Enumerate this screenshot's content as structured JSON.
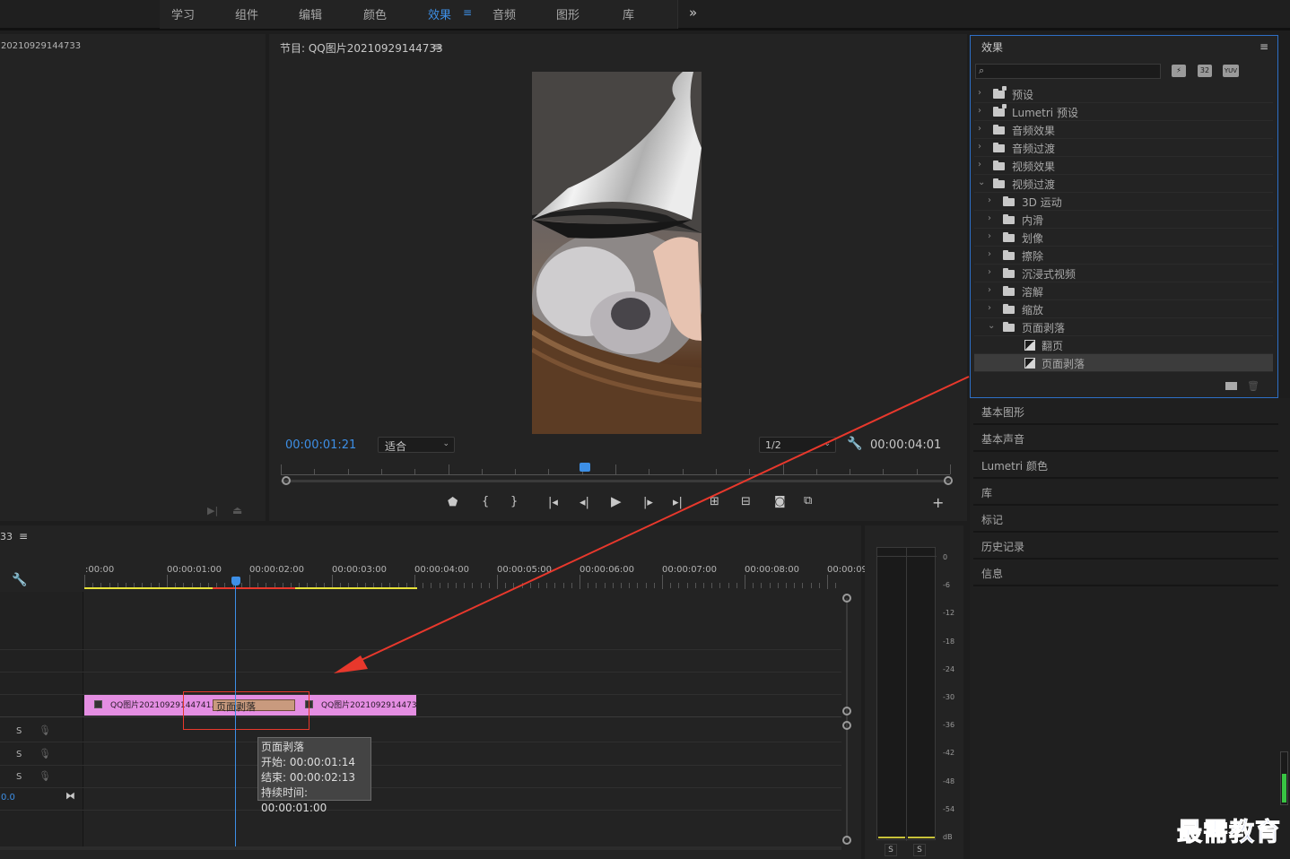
{
  "workspace_tabs": [
    {
      "label": "学习"
    },
    {
      "label": "组件"
    },
    {
      "label": "编辑"
    },
    {
      "label": "颜色"
    },
    {
      "label": "效果",
      "active": true
    },
    {
      "label": "音频"
    },
    {
      "label": "图形"
    },
    {
      "label": "库"
    }
  ],
  "workspace_menu_icon": "hamburger-icon",
  "workspace_overflow_label": "»",
  "source_panel": {
    "title": "20210929144733"
  },
  "program_monitor": {
    "title": "节目: QQ图片20210929144733",
    "current_timecode": "00:00:01:21",
    "fit_label": "适合",
    "resolution_label": "1/2",
    "duration_timecode": "00:00:04:01",
    "playhead_fraction": 0.45
  },
  "effects_panel": {
    "title": "效果",
    "search_placeholder": "",
    "filter_badges": [
      "32",
      "YUV"
    ],
    "tree": [
      {
        "label": "预设",
        "depth": 0,
        "expanded": false,
        "icon": "preset-bin-icon"
      },
      {
        "label": "Lumetri 预设",
        "depth": 0,
        "expanded": false,
        "icon": "preset-bin-icon"
      },
      {
        "label": "音频效果",
        "depth": 0,
        "expanded": false,
        "icon": "folder-icon"
      },
      {
        "label": "音频过渡",
        "depth": 0,
        "expanded": false,
        "icon": "folder-icon"
      },
      {
        "label": "视频效果",
        "depth": 0,
        "expanded": false,
        "icon": "folder-icon"
      },
      {
        "label": "视频过渡",
        "depth": 0,
        "expanded": true,
        "icon": "folder-icon"
      },
      {
        "label": "3D 运动",
        "depth": 1,
        "expanded": false,
        "icon": "folder-icon"
      },
      {
        "label": "内滑",
        "depth": 1,
        "expanded": false,
        "icon": "folder-icon"
      },
      {
        "label": "划像",
        "depth": 1,
        "expanded": false,
        "icon": "folder-icon"
      },
      {
        "label": "擦除",
        "depth": 1,
        "expanded": false,
        "icon": "folder-icon"
      },
      {
        "label": "沉浸式视频",
        "depth": 1,
        "expanded": false,
        "icon": "folder-icon"
      },
      {
        "label": "溶解",
        "depth": 1,
        "expanded": false,
        "icon": "folder-icon"
      },
      {
        "label": "缩放",
        "depth": 1,
        "expanded": false,
        "icon": "folder-icon"
      },
      {
        "label": "页面剥落",
        "depth": 1,
        "expanded": true,
        "icon": "folder-icon"
      },
      {
        "label": "翻页",
        "depth": 2,
        "icon": "transition-icon"
      },
      {
        "label": "页面剥落",
        "depth": 2,
        "icon": "transition-icon",
        "selected": true
      }
    ]
  },
  "side_panels": [
    "基本图形",
    "基本声音",
    "Lumetri 颜色",
    "库",
    "标记",
    "历史记录",
    "信息"
  ],
  "timeline": {
    "title": "33",
    "ruler_labels": [
      ":00:00",
      "00:00:01:00",
      "00:00:02:00",
      "00:00:03:00",
      "00:00:04:00",
      "00:00:05:00",
      "00:00:06:00",
      "00:00:07:00",
      "00:00:08:00",
      "00:00:09:"
    ],
    "clip_a": "QQ图片20210929144741.",
    "transition": "页面剥落",
    "clip_b": "QQ图片2021092914473",
    "audio_track_labels": [
      "S",
      "S",
      "S"
    ],
    "master_value": "0.0",
    "tooltip": {
      "name": "页面剥落",
      "start": "开始: 00:00:01:14",
      "end": "结束: 00:00:02:13",
      "duration": "持续时间: 00:00:01:00"
    }
  },
  "audio_meter": {
    "db_labels": [
      "0",
      "-6",
      "-12",
      "-18",
      "-24",
      "-30",
      "-36",
      "-42",
      "-48",
      "-54",
      "dB"
    ],
    "solo_labels": [
      "S",
      "S"
    ]
  },
  "watermark": "最需教育",
  "colors": {
    "accent": "#3d8fe6",
    "clip": "#e48ee2",
    "transition": "#c99a7e",
    "annotation": "#e8382c",
    "workarea": "#e7e23a"
  }
}
